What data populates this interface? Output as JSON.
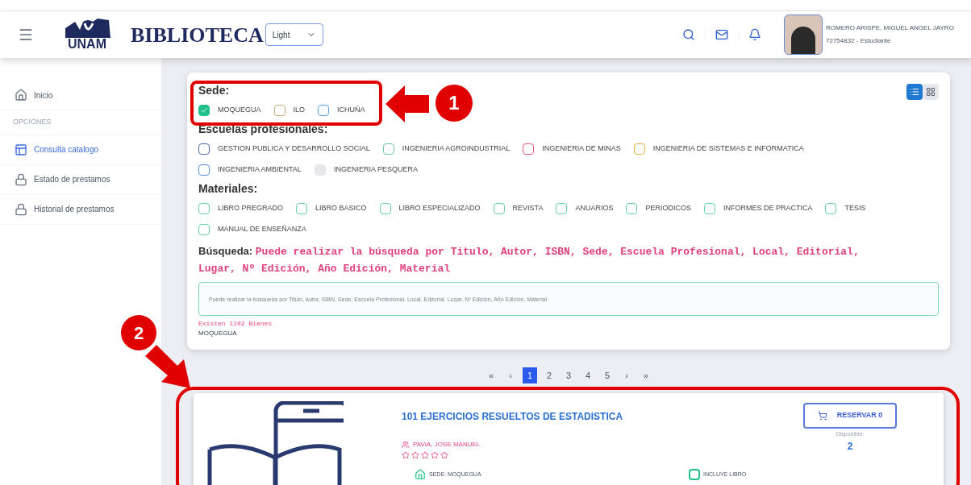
{
  "header": {
    "title": "BIBLIOTECA",
    "logo_text": "UNAM",
    "theme_select": {
      "value": "Light"
    },
    "user": {
      "name": "ROMERO ARISPE, MIGUEL ANGEL JAYRO",
      "detail": "72754832 - Estudiante"
    }
  },
  "sidebar": {
    "items": [
      {
        "kind": "link",
        "label": "Inicio",
        "selected": false
      },
      {
        "kind": "section",
        "label": "OPCIONES"
      },
      {
        "kind": "link",
        "label": "Consulta catalogo",
        "selected": true
      },
      {
        "kind": "link",
        "label": "Estado de prestamos",
        "selected": false
      },
      {
        "kind": "link",
        "label": "Historial de prestamos",
        "selected": false
      }
    ]
  },
  "view_toggle": [
    {
      "kind": "list",
      "selected": true
    },
    {
      "kind": "grid",
      "selected": false
    }
  ],
  "filters": [
    {
      "title": "Sede:",
      "options": [
        {
          "label": "MOQUEGUA",
          "checked": true,
          "color": "#22c08a"
        },
        {
          "label": "ILO",
          "checked": false,
          "color": "#c8a878"
        },
        {
          "label": "ICHUÑA",
          "checked": false,
          "color": "#5aa0e0"
        }
      ]
    },
    {
      "title": "Escuelas profesionales:",
      "options": [
        {
          "label": "GESTION PUBLICA Y DESARROLLO SOCIAL",
          "checked": false,
          "color": "#4a6aa8"
        },
        {
          "label": "INGENIERIA AGROINDUSTRIAL",
          "checked": false,
          "color": "#6cc9a8"
        },
        {
          "label": "INGENIERIA DE MINAS",
          "checked": false,
          "color": "#e05a7a"
        },
        {
          "label": "INGENIERIA DE SISTEMAS E INFORMATICA",
          "checked": false,
          "color": "#e8b040"
        },
        {
          "label": "INGENIERIA AMBIENTAL",
          "checked": false,
          "color": "#5a8ad0"
        },
        {
          "label": "INGENIERIA PESQUERA",
          "checked": false,
          "color": "#e5e7eb"
        }
      ]
    },
    {
      "title": "Materiales:",
      "options": [
        {
          "label": "LIBRO PREGRADO",
          "checked": false,
          "color": "#5fd0b0"
        },
        {
          "label": "LIBRO BASICO",
          "checked": false,
          "color": "#5fd0b0"
        },
        {
          "label": "LIBRO ESPECIALIZADO",
          "checked": false,
          "color": "#5fd0b0"
        },
        {
          "label": "REVISTA",
          "checked": false,
          "color": "#5fd0b0"
        },
        {
          "label": "ANUARIOS",
          "checked": false,
          "color": "#5fd0b0"
        },
        {
          "label": "PERIODICOS",
          "checked": false,
          "color": "#5fd0b0"
        },
        {
          "label": "INFORMES DE PRACTICA",
          "checked": false,
          "color": "#5fd0b0"
        },
        {
          "label": "TESIS",
          "checked": false,
          "color": "#5fd0b0"
        },
        {
          "label": "MANUAL DE ENSEÑANZA",
          "checked": false,
          "color": "#5fd0b0"
        }
      ]
    }
  ],
  "search": {
    "label": "Búsqueda:",
    "hint": "Puede realizar la búsqueda por Titulo, Autor, ISBN, Sede, Escuela Profesional, Local, Editorial, Lugar, Nº Edición, Año Edición, Material",
    "placeholder": "Puede realizar la búsqueda por Titulo, Autor, ISBN, Sede, Escuela Profesional, Local, Editorial, Lugar, Nº Edición, Año Edición, Material",
    "count": "Existen 1102 Bienes",
    "sede": "MOQUEGUA"
  },
  "pagination": [
    {
      "label": "«",
      "selected": false
    },
    {
      "label": "‹",
      "selected": false
    },
    {
      "label": "1",
      "selected": true
    },
    {
      "label": "2",
      "selected": false
    },
    {
      "label": "3",
      "selected": false
    },
    {
      "label": "4",
      "selected": false
    },
    {
      "label": "5",
      "selected": false
    },
    {
      "label": "›",
      "selected": false
    },
    {
      "label": "»",
      "selected": false
    }
  ],
  "results": [
    {
      "title": "101 EJERCICIOS RESUELTOS DE ESTADISTICA",
      "author": "PAVIA, JOSE MANUEL",
      "stars": 0,
      "sede": "SEDE: MOQUEGUA",
      "includes": "INCLUYE LIBRO",
      "reserve_button": "RESERVAR 0",
      "available_label": "Disponible:",
      "available": "2"
    }
  ],
  "annotations": [
    {
      "label": "1"
    },
    {
      "label": "2"
    }
  ]
}
